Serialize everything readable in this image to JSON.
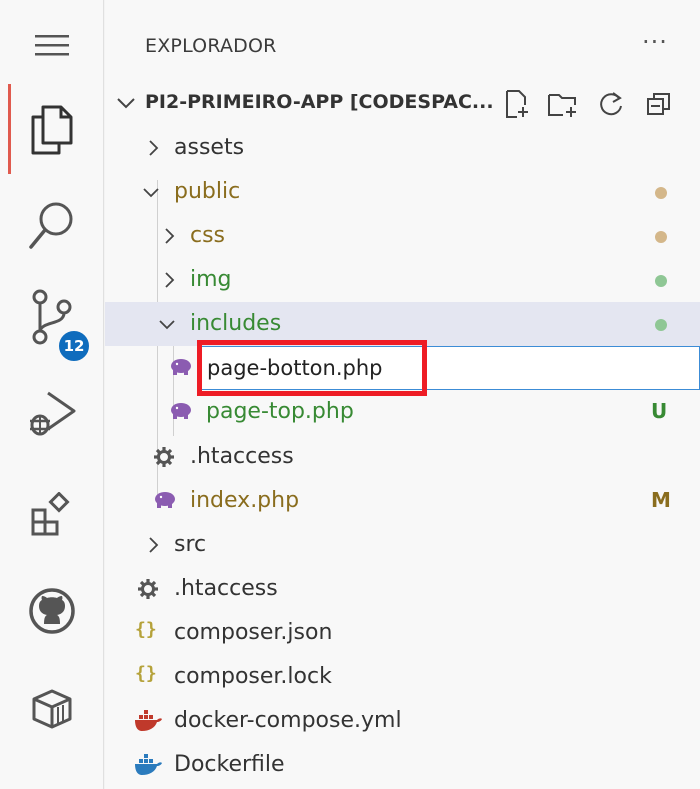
{
  "activity_bar": {
    "items": [
      {
        "name": "menu",
        "icon": "menu-icon"
      },
      {
        "name": "explorer",
        "icon": "files-icon",
        "active": true
      },
      {
        "name": "search",
        "icon": "search-icon"
      },
      {
        "name": "source-control",
        "icon": "source-control-icon",
        "badge": "12"
      },
      {
        "name": "run-debug",
        "icon": "run-debug-icon"
      },
      {
        "name": "extensions",
        "icon": "extensions-icon"
      },
      {
        "name": "github",
        "icon": "github-icon"
      },
      {
        "name": "remote-explorer",
        "icon": "remote-explorer-icon"
      }
    ],
    "badge_color": "#0f6cbd"
  },
  "sidebar": {
    "title": "EXPLORADOR",
    "more": "···",
    "project": {
      "name": "PI2-PRIMEIRO-APP [CODESPAC...",
      "actions": [
        "new-file-icon",
        "new-folder-icon",
        "refresh-icon",
        "collapse-all-icon"
      ]
    },
    "tree": [
      {
        "label": "assets",
        "type": "folder",
        "expanded": false,
        "status": ""
      },
      {
        "label": "public",
        "type": "folder",
        "expanded": true,
        "status": "modified-dot"
      },
      {
        "label": "css",
        "type": "folder",
        "expanded": false,
        "status": "modified-dot"
      },
      {
        "label": "img",
        "type": "folder",
        "expanded": false,
        "status": "new-dot"
      },
      {
        "label": "includes",
        "type": "folder",
        "expanded": true,
        "status": "new-dot"
      },
      {
        "label": "page-top.php",
        "type": "php",
        "status": "U"
      },
      {
        "label": ".htaccess",
        "type": "gear",
        "status": ""
      },
      {
        "label": "index.php",
        "type": "php",
        "status": "M"
      },
      {
        "label": "src",
        "type": "folder",
        "expanded": false,
        "status": ""
      },
      {
        "label": ".htaccess",
        "type": "gear",
        "status": ""
      },
      {
        "label": "composer.json",
        "type": "json",
        "status": ""
      },
      {
        "label": "composer.lock",
        "type": "json",
        "status": ""
      },
      {
        "label": "docker-compose.yml",
        "type": "docker",
        "status": ""
      },
      {
        "label": "Dockerfile",
        "type": "docker",
        "status": ""
      }
    ],
    "rename": {
      "value": "page-botton.php"
    }
  },
  "colors": {
    "modified": "#8a6d1e",
    "untracked": "#388a34",
    "modified_dot": "#d4b78a",
    "untracked_dot": "#8fc795",
    "php_icon": "#8b5cb1",
    "docker_icon": "#2b7bbd",
    "json_icon": "#b5a23a",
    "highlight": "#ee1c25"
  }
}
